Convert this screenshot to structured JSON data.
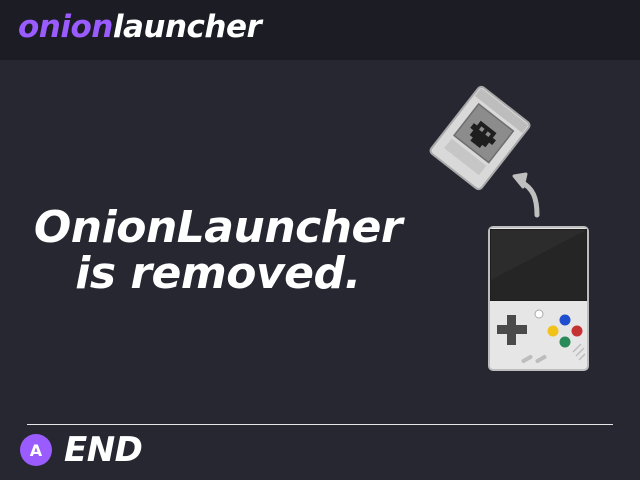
{
  "app": {
    "logo_part1": "onion",
    "logo_part2": "launcher"
  },
  "message": {
    "line1": "OnionLauncher",
    "line2": "is removed."
  },
  "footer": {
    "button_glyph": "A",
    "button_label": "END"
  },
  "colors": {
    "background": "#262731",
    "topbar": "#1c1c25",
    "accent": "#9b5cff",
    "text": "#ffffff"
  },
  "icons": {
    "cartridge": "game-cartridge-icon",
    "arrow": "curved-arrow-up-icon",
    "device": "handheld-console-icon"
  }
}
